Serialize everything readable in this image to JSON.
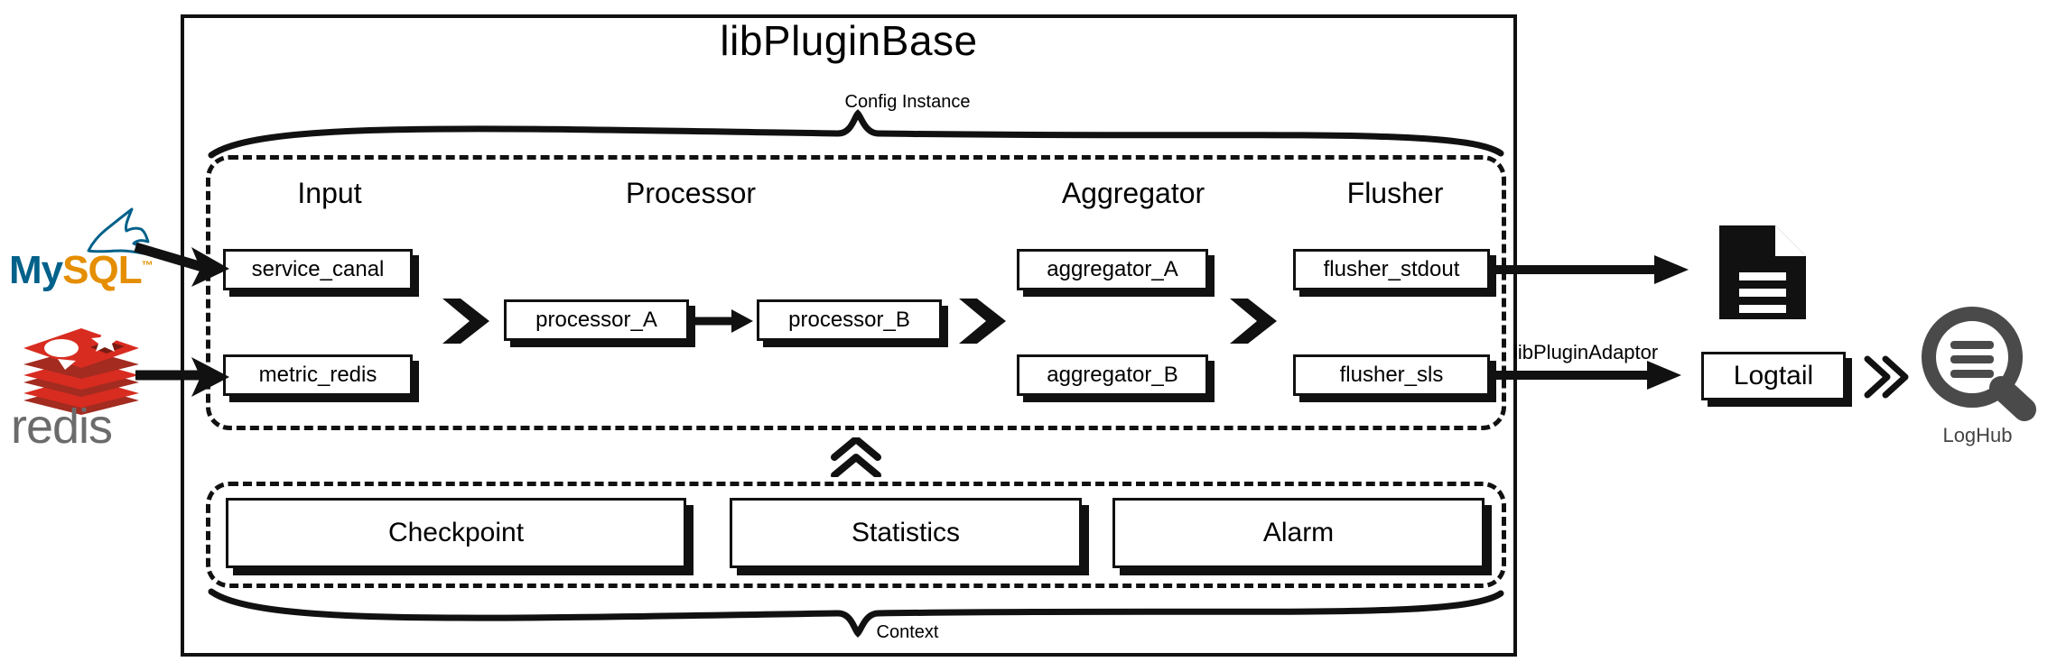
{
  "diagram": {
    "title": "libPluginBase",
    "top_brace_label": "Config Instance",
    "bottom_brace_label": "Context",
    "adaptor_label": "libPluginAdaptor",
    "columns": [
      {
        "name": "input-column",
        "label": "Input"
      },
      {
        "name": "processor-column",
        "label": "Processor"
      },
      {
        "name": "aggregator-column",
        "label": "Aggregator"
      },
      {
        "name": "flusher-column",
        "label": "Flusher"
      }
    ],
    "input_nodes": [
      {
        "label": "service_canal"
      },
      {
        "label": "metric_redis"
      }
    ],
    "processor_nodes": [
      {
        "label": "processor_A"
      },
      {
        "label": "processor_B"
      }
    ],
    "aggregator_nodes": [
      {
        "label": "aggregator_A"
      },
      {
        "label": "aggregator_B"
      }
    ],
    "flusher_nodes": [
      {
        "label": "flusher_stdout"
      },
      {
        "label": "flusher_sls"
      }
    ],
    "support_nodes": [
      {
        "label": "Checkpoint"
      },
      {
        "label": "Statistics"
      },
      {
        "label": "Alarm"
      }
    ],
    "sources": [
      {
        "name": "mysql",
        "part1": "My",
        "part2": "SQL",
        "tm": "™"
      },
      {
        "name": "redis",
        "label": "redis"
      }
    ],
    "sinks": [
      {
        "name": "stdout-document",
        "label": ""
      },
      {
        "name": "logtail",
        "label": "Logtail"
      },
      {
        "name": "loghub",
        "label": "LogHub"
      }
    ],
    "icons": {
      "up_chevron": "double-chevron-up-icon",
      "right_chevron": "double-chevron-right-icon",
      "document": "document-icon",
      "magnifier": "magnifier-icon",
      "dolphin": "mysql-dolphin-icon",
      "redis_stack": "redis-stack-icon"
    },
    "colors": {
      "line": "#111111",
      "mysql_blue": "#00618a",
      "mysql_orange": "#e48e00",
      "redis_red": "#d82c20",
      "redis_gray": "#6b6b6b",
      "loghub_gray": "#4a4a4a"
    }
  }
}
